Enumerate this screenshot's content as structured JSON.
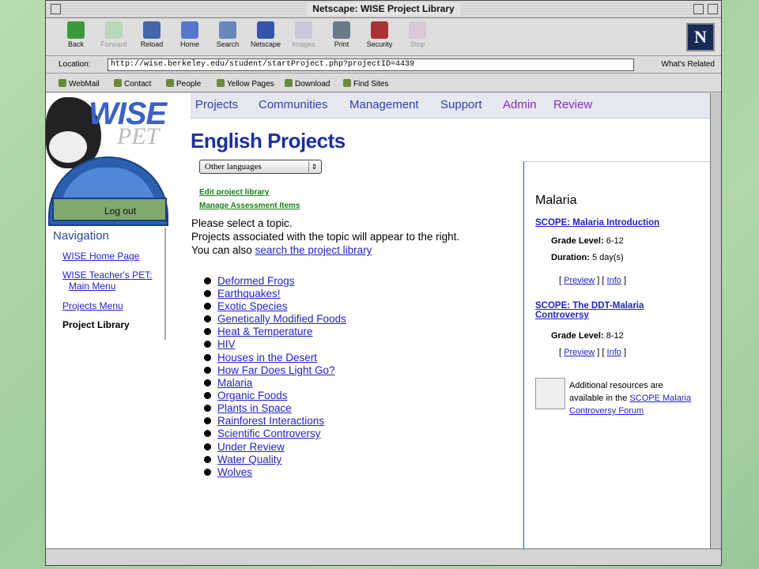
{
  "window": {
    "title": "Netscape: WISE Project Library"
  },
  "toolbar": {
    "buttons": [
      "Back",
      "Forward",
      "Reload",
      "Home",
      "Search",
      "Netscape",
      "Images",
      "Print",
      "Security",
      "Stop"
    ],
    "logo": "N"
  },
  "location": {
    "label": "Location:",
    "url": "http://wise.berkeley.edu/student/startProject.php?projectID=4439",
    "related": "What's Related"
  },
  "personal": {
    "items": [
      "WebMail",
      "Contact",
      "People",
      "Yellow Pages",
      "Download",
      "Find Sites"
    ]
  },
  "logo": {
    "main": "WISE",
    "sub": "PET"
  },
  "sidebar": {
    "logout": "Log out",
    "nav_title": "Navigation",
    "links": [
      "WISE Home Page",
      "WISE Teacher's PET:",
      "Main Menu",
      "Projects Menu"
    ],
    "current": "Project Library"
  },
  "topnav": {
    "items": [
      "Projects",
      "Communities",
      "Management",
      "Support",
      "Admin",
      "Review"
    ]
  },
  "main": {
    "title": "English Projects",
    "select_value": "Other languages",
    "edit_link": "Edit project library",
    "manage_link": "Manage Assessment Items",
    "intro1": "Please select a topic.",
    "intro2": "Projects associated with the topic will appear to the right.",
    "intro3_prefix": "You can also ",
    "intro3_link": "search the project library",
    "topics": [
      "Deformed Frogs",
      "Earthquakes!",
      "Exotic Species",
      "Genetically Modified Foods",
      "Heat & Temperature",
      "HIV",
      "Houses in the Desert",
      "How Far Does Light Go?",
      "Malaria",
      "Organic Foods",
      "Plants in Space",
      "Rainforest Interactions",
      "Scientific Controversy",
      "Under Review",
      "Water Quality",
      "Wolves"
    ]
  },
  "right": {
    "topic": "Malaria",
    "p1_title": "SCOPE: Malaria Introduction",
    "p1_grade_label": "Grade Level:",
    "p1_grade": "6-12",
    "p1_duration_label": "Duration:",
    "p1_duration": "5 day(s)",
    "preview": "Preview",
    "info": "Info",
    "p2_title_1": "SCOPE: The DDT-Malaria",
    "p2_title_2": "Controversy",
    "p2_grade_label": "Grade Level:",
    "p2_grade": "8-12",
    "res_text": "Additional resources are available in the ",
    "res_link": "SCOPE Malaria Controversy Forum"
  },
  "colors": {
    "accent": "#1b2fa0",
    "link": "#2222cc",
    "admin": "#8a2ab8",
    "green_link": "#188018"
  }
}
